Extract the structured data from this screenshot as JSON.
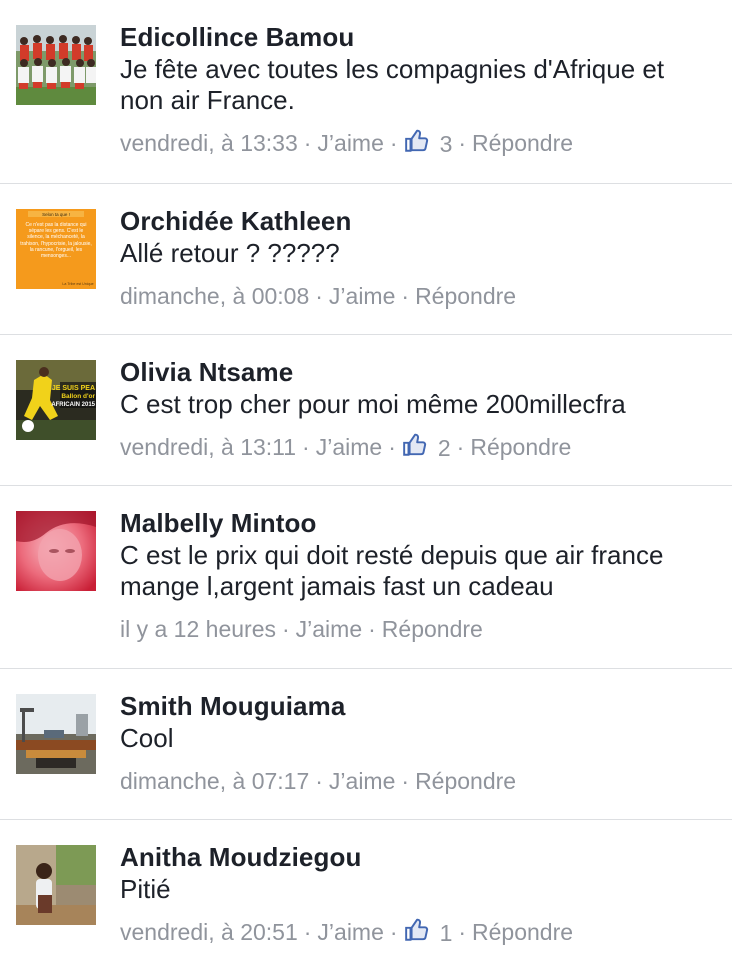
{
  "colors": {
    "name": "#1d2129",
    "meta": "#90949c",
    "divider": "#dddfe2",
    "like_blue": "#4267b2"
  },
  "separator": "·",
  "comments": [
    {
      "author": "Edicollince Bamou",
      "text": "Je fête avec toutes les compagnies d'Afrique et non air France.",
      "time": "vendredi, à 13:33",
      "like_label": "J’aime",
      "likes": "3",
      "reply_label": "Répondre",
      "avatar_icon": "team-photo-avatar"
    },
    {
      "author": "Orchidée Kathleen",
      "text": "Allé retour ? ?????",
      "time": "dimanche, à 00:08",
      "like_label": "J’aime",
      "reply_label": "Répondre",
      "avatar_icon": "quote-card-avatar",
      "avatar_text": {
        "header": "Selon ta que !",
        "body": "Ce n'est pas la distance qui sépare les gens. C'est le silence, la méchanceté, la trahison, l'hypocrisie, la jalousie, la rancune, l'orgueil, les mensonges...",
        "footer": "La Tribe est Unique"
      }
    },
    {
      "author": "Olivia Ntsame",
      "text": "C est trop cher pour moi même 200millecfra",
      "time": "vendredi, à 13:11",
      "like_label": "J’aime",
      "likes": "2",
      "reply_label": "Répondre",
      "avatar_icon": "football-poster-avatar",
      "avatar_text": {
        "line1": "JE SUIS PEA",
        "line2": "Ballon d'or",
        "line3": "AFRICAIN 2015"
      }
    },
    {
      "author": "Malbelly Mintoo",
      "text": "C est le prix qui doit resté depuis que air france mange l,argent jamais fast un cadeau",
      "time": "il y a 12 heures",
      "like_label": "J’aime",
      "reply_label": "Répondre",
      "avatar_icon": "portrait-red-avatar"
    },
    {
      "author": "Smith Mouguiama",
      "text": "Cool",
      "time": "dimanche, à 07:17",
      "like_label": "J’aime",
      "reply_label": "Répondre",
      "avatar_icon": "construction-site-avatar"
    },
    {
      "author": "Anitha Moudziegou",
      "text": "Pitié",
      "time": "vendredi, à 20:51",
      "like_label": "J’aime",
      "likes": "1",
      "reply_label": "Répondre",
      "avatar_icon": "person-photo-avatar"
    }
  ]
}
